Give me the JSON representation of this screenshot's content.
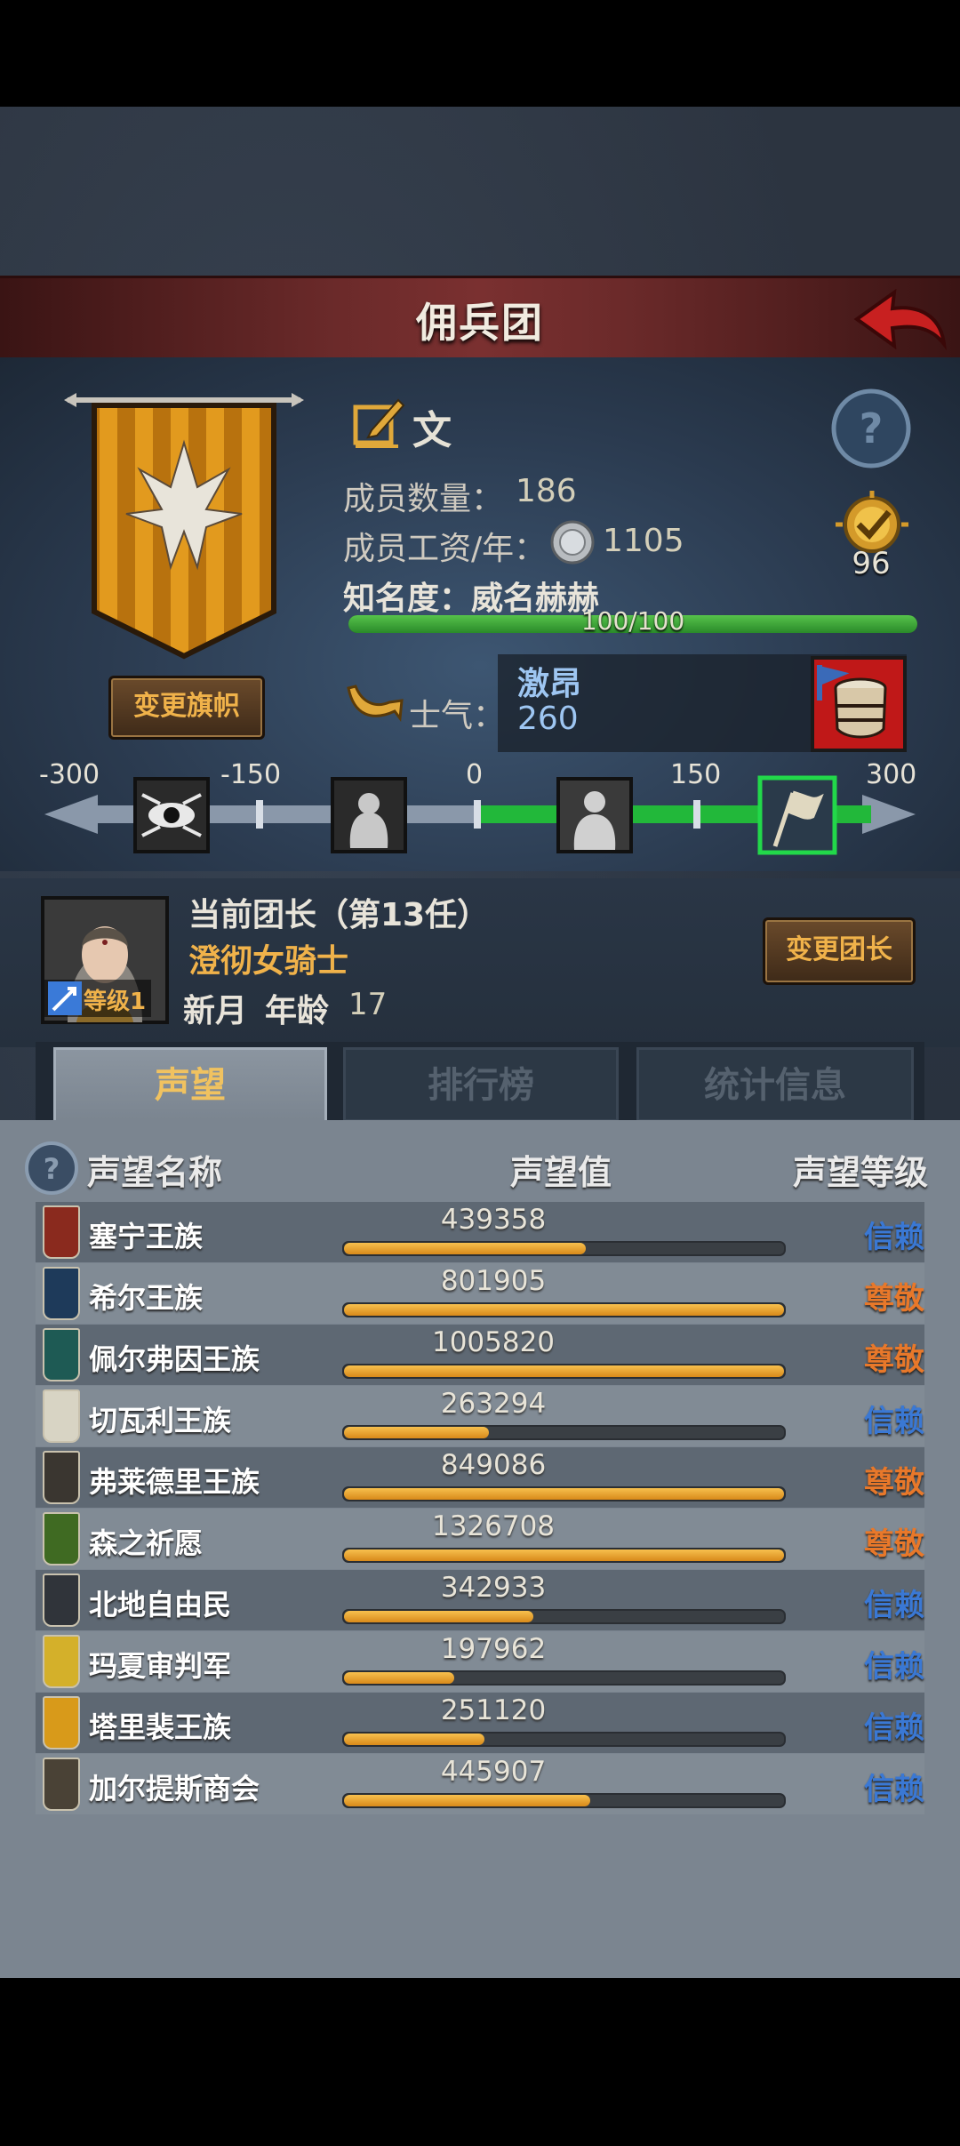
{
  "header": {
    "title": "佣兵团"
  },
  "company": {
    "name": "文",
    "member_count_label": "成员数量：",
    "member_count": "186",
    "salary_label": "成员工资/年：",
    "salary": "1105",
    "fame_label": "知名度：",
    "fame_value": "威名赫赫",
    "fame_progress_text": "100/100",
    "fame_progress": 1.0,
    "badge_value": "96",
    "change_banner_label": "变更旗帜"
  },
  "morale": {
    "label": "士气：",
    "state": "激昂",
    "value": "260",
    "scale_ticks": [
      "-300",
      "-150",
      "0",
      "150",
      "300"
    ],
    "scale_min": -300,
    "scale_max": 300
  },
  "leader": {
    "title": "当前团长（第13任）",
    "class": "澄彻女骑士",
    "name": "新月",
    "age_label": "年龄",
    "age": "17",
    "level_label": "等级1",
    "change_label": "变更团长"
  },
  "tabs": [
    {
      "label": "声望",
      "active": true
    },
    {
      "label": "排行榜",
      "active": false
    },
    {
      "label": "统计信息",
      "active": false
    }
  ],
  "table": {
    "headers": {
      "name": "声望名称",
      "value": "声望值",
      "level": "声望等级"
    },
    "rows": [
      {
        "name": "塞宁王族",
        "value": "439358",
        "progress": 0.55,
        "level": "信赖",
        "level_color": "#3a78d4",
        "icon_color": "#8a2a1e"
      },
      {
        "name": "希尔王族",
        "value": "801905",
        "progress": 1.0,
        "level": "尊敬",
        "level_color": "#e8782a",
        "icon_color": "#1e3a5a"
      },
      {
        "name": "佩尔弗因王族",
        "value": "1005820",
        "progress": 1.0,
        "level": "尊敬",
        "level_color": "#e8782a",
        "icon_color": "#1e5a54"
      },
      {
        "name": "切瓦利王族",
        "value": "263294",
        "progress": 0.33,
        "level": "信赖",
        "level_color": "#3a78d4",
        "icon_color": "#d8d4c4"
      },
      {
        "name": "弗莱德里王族",
        "value": "849086",
        "progress": 1.0,
        "level": "尊敬",
        "level_color": "#e8782a",
        "icon_color": "#3a3630"
      },
      {
        "name": "森之祈愿",
        "value": "1326708",
        "progress": 1.0,
        "level": "尊敬",
        "level_color": "#e8782a",
        "icon_color": "#3f6a22"
      },
      {
        "name": "北地自由民",
        "value": "342933",
        "progress": 0.43,
        "level": "信赖",
        "level_color": "#3a78d4",
        "icon_color": "#30343a"
      },
      {
        "name": "玛夏审判军",
        "value": "197962",
        "progress": 0.25,
        "level": "信赖",
        "level_color": "#3a78d4",
        "icon_color": "#d4b02a"
      },
      {
        "name": "塔里裴王族",
        "value": "251120",
        "progress": 0.32,
        "level": "信赖",
        "level_color": "#3a78d4",
        "icon_color": "#d89a1a"
      },
      {
        "name": "加尔提斯商会",
        "value": "445907",
        "progress": 0.56,
        "level": "信赖",
        "level_color": "#3a78d4",
        "icon_color": "#4a4236"
      }
    ]
  }
}
